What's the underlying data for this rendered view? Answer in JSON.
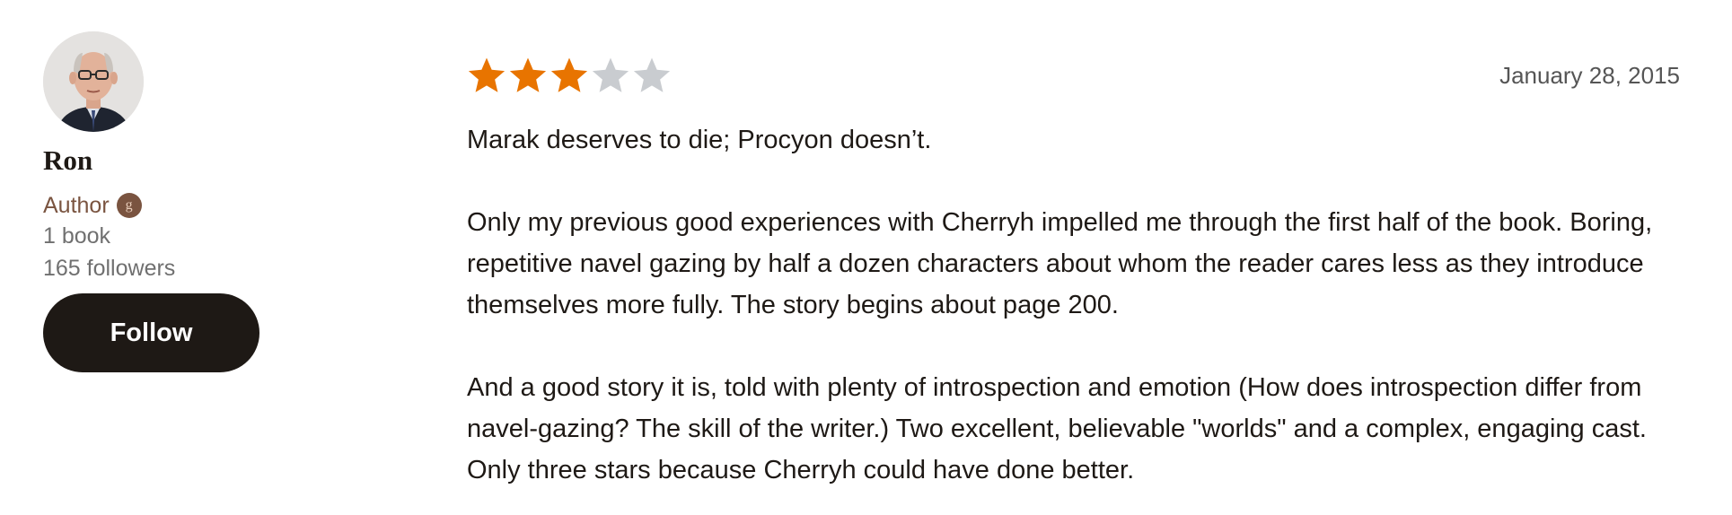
{
  "reviewer": {
    "name": "Ron",
    "role": "Author",
    "badge_letter": "g",
    "books": "1 book",
    "followers": "165 followers",
    "follow_label": "Follow"
  },
  "review": {
    "rating": 3,
    "rating_max": 5,
    "date": "January 28, 2015",
    "paragraphs": [
      "Marak deserves to die; Procyon doesn’t.",
      "Only my previous good experiences with Cherryh impelled me through the first half of the book. Boring, repetitive navel gazing by half a dozen characters about whom the reader cares less as they introduce themselves more fully. The story begins about page 200.",
      "And a good story it is, told with plenty of introspection and emotion (How does introspection differ from navel-gazing? The skill of the writer.) Two excellent, believable \"worlds\" and a complex, engaging cast. Only three stars because Cherryh could have done better."
    ]
  },
  "colors": {
    "star_filled": "#e87400",
    "star_empty": "#c9ccd0",
    "button_bg": "#1e1915",
    "author_brown": "#7a5440"
  }
}
